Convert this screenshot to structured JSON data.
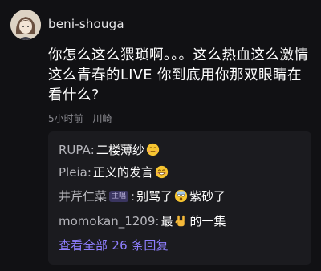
{
  "comment": {
    "username": "beni-shouga",
    "text": "你怎么这么猥琐啊。。。这么热血这么激情这么青春的LIVE 你到底用你那双眼睛在看什么?",
    "time": "5小时前",
    "location": "川崎"
  },
  "replies": [
    {
      "name": "RUPA",
      "sep": ":",
      "text": "二楼薄纱",
      "emoji": "smiling-face-emoji"
    },
    {
      "name": "Pleia",
      "sep": ":",
      "text": "正义的发言",
      "emoji": "grinning-face-emoji"
    },
    {
      "name": "井芹仁菜",
      "badge": "主唱",
      "sep": ":",
      "text_before": "别骂了",
      "emoji": "shocked-face-emoji",
      "text_after": "紫砂了"
    },
    {
      "name": "momokan_1209",
      "sep": ":",
      "text_before": "最",
      "emoji": "rock-hand-emoji",
      "text_after": "的一集"
    }
  ],
  "view_all": "查看全部 26 条回复",
  "colors": {
    "background": "#111114",
    "reply_box": "#1b1b1f",
    "link": "#8f7fff",
    "meta": "#8a8a90"
  }
}
